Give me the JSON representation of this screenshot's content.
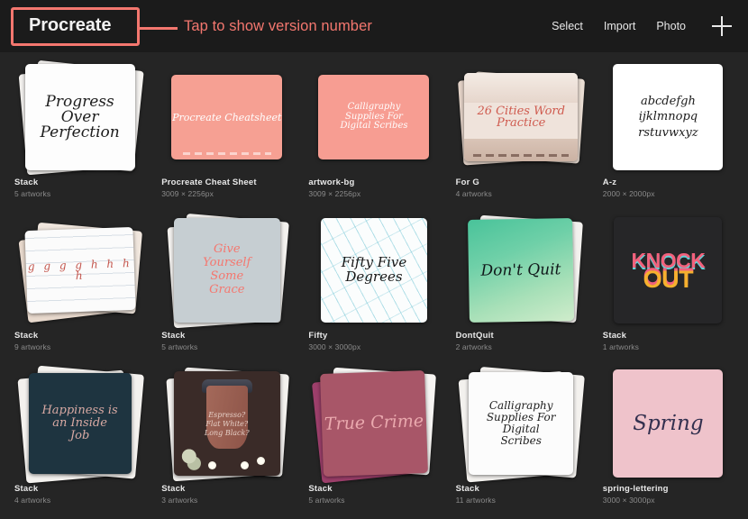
{
  "header": {
    "brand": "Procreate",
    "annotation": "Tap to show version number",
    "annotation_color": "#f4776f",
    "nav": [
      {
        "label": "Select",
        "name": "select"
      },
      {
        "label": "Import",
        "name": "import"
      },
      {
        "label": "Photo",
        "name": "photo"
      }
    ],
    "add_icon": "plus-icon"
  },
  "gallery": {
    "items": [
      {
        "title": "Stack",
        "sub": "5 artworks",
        "art_text": "Progress Over Perfection",
        "kind": "stack"
      },
      {
        "title": "Procreate Cheat Sheet",
        "sub": "3009 × 2256px",
        "art_text": "Procreate Cheatsheet",
        "kind": "single"
      },
      {
        "title": "artwork-bg",
        "sub": "3009 × 2256px",
        "art_text": "Calligraphy Supplies For Digital Scribes",
        "kind": "single"
      },
      {
        "title": "For G",
        "sub": "4 artworks",
        "art_text": "26 Cities Word Practice",
        "kind": "stack"
      },
      {
        "title": "A-z",
        "sub": "2000 × 2000px",
        "art_text": "abcdefgh ijklmnopq rstuvwxyz",
        "kind": "single"
      },
      {
        "title": "Stack",
        "sub": "9 artworks",
        "art_text": "g g g g  h h h h",
        "kind": "stack"
      },
      {
        "title": "Stack",
        "sub": "5 artworks",
        "art_text": "Give Yourself Some Grace",
        "kind": "stack"
      },
      {
        "title": "Fifty",
        "sub": "3000 × 3000px",
        "art_text": "Fifty Five Degrees",
        "kind": "single"
      },
      {
        "title": "DontQuit",
        "sub": "2 artworks",
        "art_text": "Don't Quit",
        "kind": "stack"
      },
      {
        "title": "Stack",
        "sub": "1 artworks",
        "art_text": "KNOCK OUT",
        "kind": "single"
      },
      {
        "title": "Stack",
        "sub": "4 artworks",
        "art_text": "Happiness is an Inside Job",
        "kind": "stack"
      },
      {
        "title": "Stack",
        "sub": "3 artworks",
        "art_text": "Espresso? Flat White? Long Black?",
        "kind": "stack"
      },
      {
        "title": "Stack",
        "sub": "5 artworks",
        "art_text": "True Crime",
        "kind": "stack"
      },
      {
        "title": "Stack",
        "sub": "11 artworks",
        "art_text": "Calligraphy Supplies For Digital Scribes",
        "kind": "stack"
      },
      {
        "title": "spring-lettering",
        "sub": "3000 × 3000px",
        "art_text": "Spring",
        "kind": "single"
      }
    ]
  }
}
